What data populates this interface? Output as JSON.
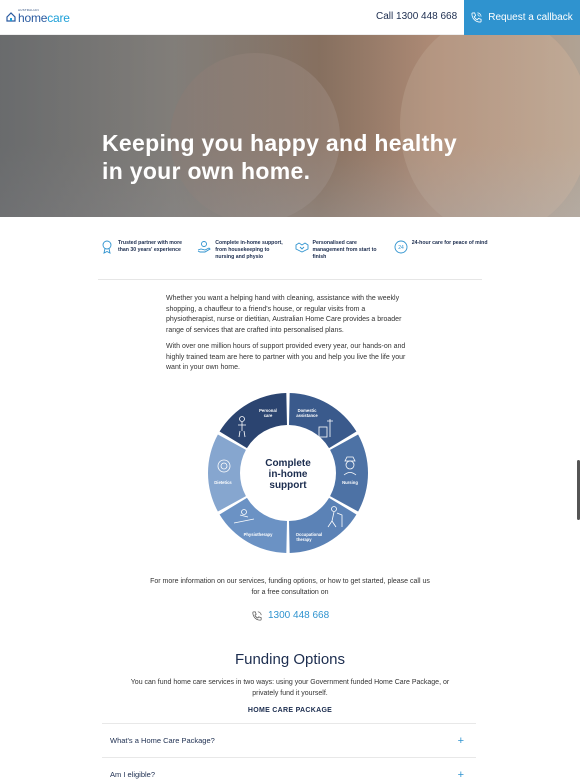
{
  "header": {
    "logo_small": "AUSTRALIAN",
    "logo_home": "home",
    "logo_care": "care",
    "call_label": "Call 1300 448 668",
    "callback_label": "Request a callback"
  },
  "hero": {
    "title": "Keeping you happy and healthy in your own home."
  },
  "features": [
    {
      "icon": "award-icon",
      "text": "Trusted partner with more than 30 years' experience"
    },
    {
      "icon": "helping-hand-icon",
      "text": "Complete in-home support, from housekeeping to nursing and physio"
    },
    {
      "icon": "handshake-icon",
      "text": "Personalised care management from start to finish"
    },
    {
      "icon": "clock-24-icon",
      "text": "24-hour care for peace of mind"
    }
  ],
  "intro": {
    "p1": "Whether you want a helping hand with cleaning, assistance with the weekly shopping, a chauffeur to a friend's house, or regular visits from a physiotherapist, nurse or dietitian, Australian Home Care provides a broader range of services that are crafted into personalised plans.",
    "p2": "With over one million hours of support provided every year, our hands-on and highly trained team are here to partner with you and help you live the life your want in your own home."
  },
  "wheel": {
    "center_line1": "Complete",
    "center_line2": "in-home",
    "center_line3": "support",
    "segments": [
      {
        "label1": "Personal",
        "label2": "care",
        "color": "#2b4470"
      },
      {
        "label1": "Domestic",
        "label2": "assistance",
        "color": "#3a5a8c"
      },
      {
        "label1": "Nursing",
        "label2": "",
        "color": "#4d72a5"
      },
      {
        "label1": "Occupational",
        "label2": "therapy",
        "color": "#5b82b6"
      },
      {
        "label1": "Physiotherapy",
        "label2": "",
        "color": "#6b92c4"
      },
      {
        "label1": "Dietetics",
        "label2": "",
        "color": "#86a6cf"
      }
    ]
  },
  "more_info": "For more information on our services, funding options, or how to get started, please call us for a free consultation on",
  "phone_cta": "1300 448 668",
  "funding": {
    "title": "Funding Options",
    "text": "You can fund home care services in two ways: using your Government funded Home Care Package, or privately fund it yourself.",
    "package_label": "HOME CARE PACKAGE"
  },
  "accordion": [
    {
      "label": "What's a Home Care Package?",
      "toggle": "+"
    },
    {
      "label": "Am I eligible?",
      "toggle": "+"
    }
  ],
  "colors": {
    "brand_blue": "#2f93cf",
    "navy": "#1c2d4f"
  }
}
